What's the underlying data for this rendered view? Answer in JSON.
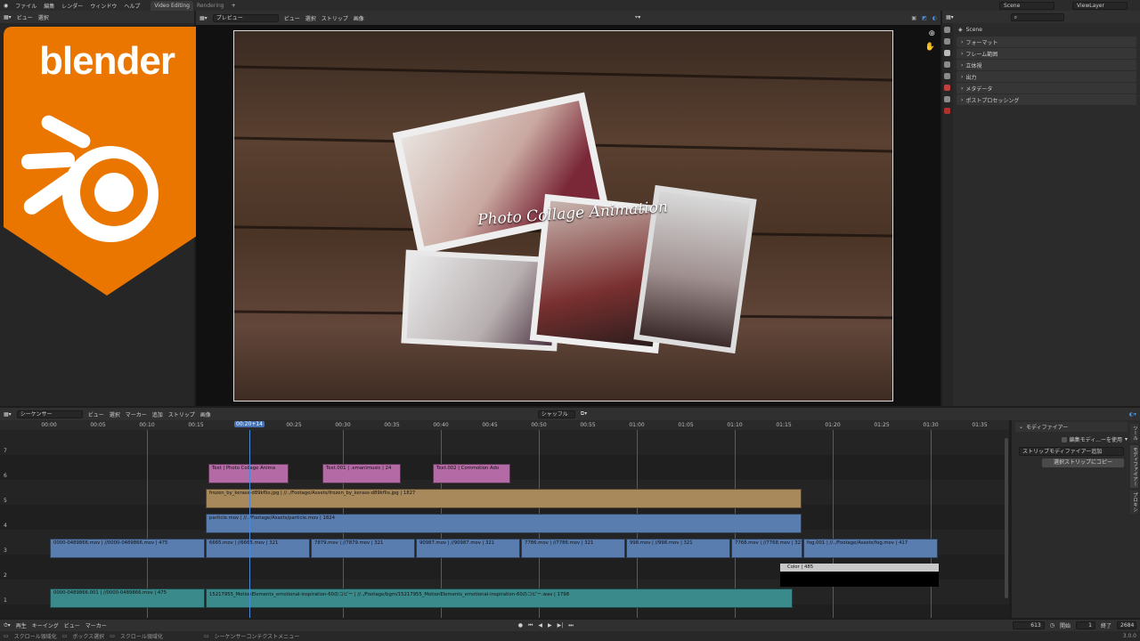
{
  "topbar": {
    "menus": [
      "ファイル",
      "編集",
      "レンダー",
      "ウィンドウ",
      "ヘルプ"
    ],
    "tabs": [
      "Video Editing",
      "Rendering",
      "+"
    ],
    "scene": "Scene",
    "view_layer": "ViewLayer"
  },
  "left_area": {
    "menus": [
      "ビュー",
      "選択"
    ]
  },
  "logo_text": "blender",
  "preview": {
    "mode": "プレビュー",
    "menus": [
      "ビュー",
      "選択",
      "ストリップ",
      "画像"
    ],
    "title_overlay": "Photo Collage Animation"
  },
  "properties": {
    "scene_label": "Scene",
    "panels": [
      "フォーマット",
      "フレーム範囲",
      "立体視",
      "出力",
      "メタデータ",
      "ポストプロセッシング"
    ]
  },
  "sequencer": {
    "editor": "シーケンサー",
    "menus": [
      "ビュー",
      "選択",
      "マーカー",
      "追加",
      "ストリップ",
      "画像"
    ],
    "snap": "シャッフル",
    "playhead": "00:20+14",
    "ticks": [
      "00:00",
      "00:05",
      "00:10",
      "00:15",
      "00:20",
      "00:25",
      "00:30",
      "00:35",
      "00:40",
      "00:45",
      "00:50",
      "00:55",
      "01:00",
      "01:05",
      "01:10",
      "01:15",
      "01:20",
      "01:25",
      "01:30",
      "01:35"
    ],
    "channels": [
      "7",
      "6",
      "5",
      "4",
      "3",
      "2",
      "1"
    ],
    "strips": {
      "t1": "Text | Photo Collage Anima",
      "t2": "Text.001 | .emanimusic | 24",
      "t3": "Text.002 | Commotion Ado",
      "img": "frozen_by_kerass-d89kflio.jpg | //../Footage/Assets/frozen_by_kerass-d89kflio.jpg | 1827",
      "particle": "particle.mov | //../Footage/Assets/particle.mov | 1824",
      "m0": "0000-0489866.mov | //0000-0489866.mov | 475",
      "m1": "6665.mov | //6665.mov | 321",
      "m2": "7879.mov | //7879.mov | 321",
      "m3": "90987.mov | //90987.mov | 321",
      "m4": "7786.mov | //7786.mov | 321",
      "m5": "998.mov | //998.mov | 321",
      "m6": "7768.mov | //7768.mov | 321",
      "m7": "fog.001 | //../Footage/Assets/fog.mov | 417",
      "color": "Color | 485",
      "a0": "0000-0489866.001 | //0000-0489866.mov | 475",
      "a1": "15217955_MotionElements_emotional-inspiration-60のコピー | //../Footage/bgm/15217955_MotionElements_emotional-inspiration-60のコピー.wav | 1798"
    }
  },
  "modifier_panel": {
    "header": "モディファイアー",
    "checkbox": "編集モディ...ーを使用",
    "add": "ストリップモディファイアー追加",
    "copy": "選択ストリップにコピー",
    "side_tabs": [
      "ツール",
      "モディファイアー",
      "プロキシ"
    ]
  },
  "playback": {
    "menus": [
      "再生",
      "キーイング",
      "ビュー",
      "マーカー"
    ],
    "current_frame": "613",
    "start_label": "開始",
    "start": "1",
    "end_label": "終了",
    "end": "2684"
  },
  "status": {
    "items": [
      "スクロール領域化",
      "ボックス選択",
      "スクロール領域化",
      "シーケンサーコンテクストメニュー"
    ],
    "version": "3.0.0"
  }
}
